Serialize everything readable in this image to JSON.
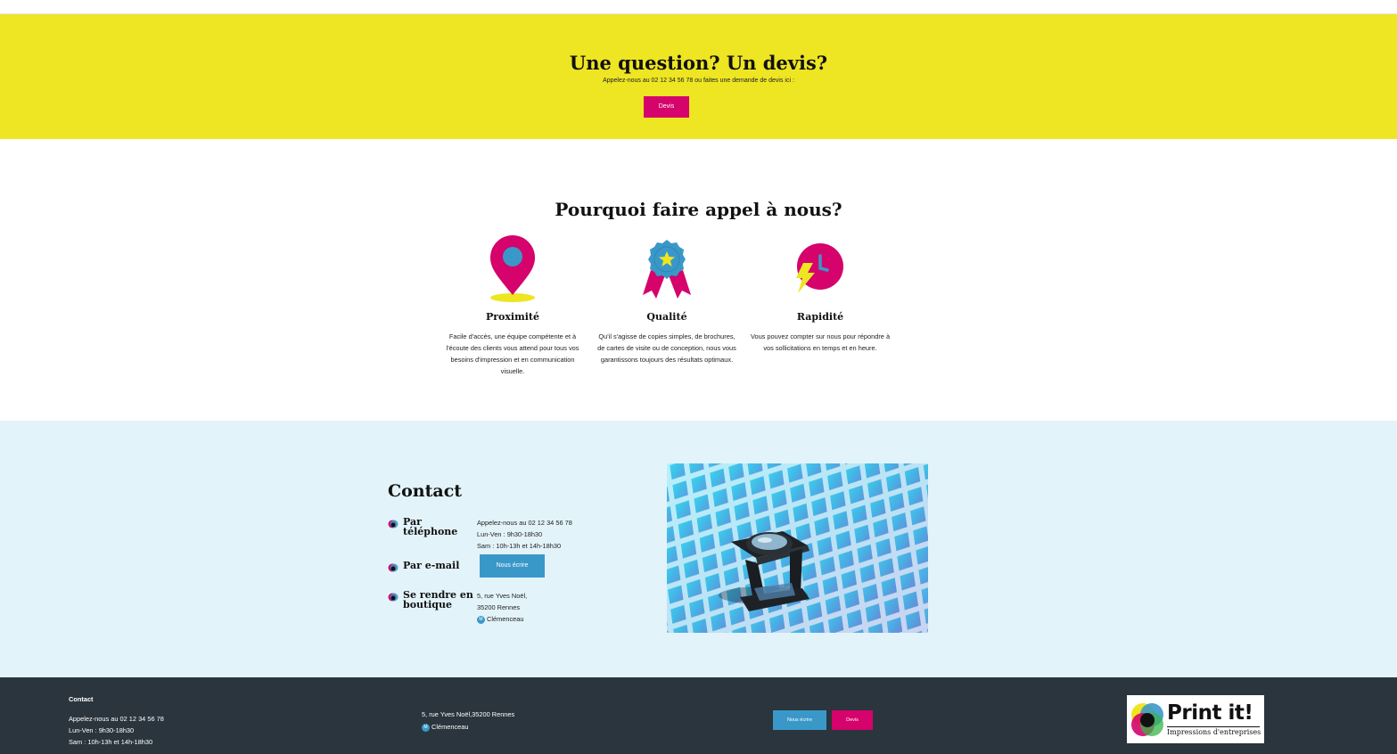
{
  "cta": {
    "title": "Une question? Un devis?",
    "subtitle": "Appelez-nous au 02 12 34 56 78 ou faites une demande de devis ici :",
    "button": "Devis"
  },
  "why": {
    "title": "Pourquoi faire appel à nous?",
    "features": [
      {
        "title": "Proximité",
        "text": "Facile d'accès, une équipe compétente et à l'écoute des clients vous attend pour tous vos besoins d'impression et en communication visuelle.",
        "icon": "location-pin-icon"
      },
      {
        "title": "Qualité",
        "text": "Qu'il s'agisse de copies simples, de brochures, de cartes de visite ou de conception, nous vous garantissons toujours des résultats optimaux.",
        "icon": "award-ribbon-icon"
      },
      {
        "title": "Rapidité",
        "text": "Vous pouvez compter sur nous pour répondre à vos sollicitations en temps et en heure.",
        "icon": "clock-lightning-icon"
      }
    ]
  },
  "contact": {
    "title": "Contact",
    "phone": {
      "label": "Par téléphone",
      "lines": [
        "Appelez-nous au 02 12 34 56 78",
        "Lun-Ven : 9h30-18h30",
        "Sam : 10h-13h et 14h-18h30"
      ]
    },
    "email": {
      "label": "Par e-mail",
      "button": "Nous écrire"
    },
    "shop": {
      "label": "Se rendre en boutique",
      "lines": [
        "5, rue Yves Noël,",
        "35200 Rennes"
      ],
      "metro_badge": "M",
      "metro": "Clémenceau"
    }
  },
  "footer": {
    "title": "Contact",
    "lines": [
      "Appelez-nous au 02 12 34 56 78",
      "Lun-Ven : 9h30-18h30",
      "Sam : 10h-13h et 14h-18h30"
    ],
    "address": "5, rue Yves Noël,35200 Rennes",
    "metro_badge": "M",
    "metro": "Clémenceau",
    "button_write": "Nous écrire",
    "button_quote": "Devis",
    "logo_name": "Print it!",
    "logo_tagline": "Impressions d'entreprises"
  },
  "colors": {
    "yellow": "#eee523",
    "magenta": "#d5036b",
    "blue": "#3a98c9",
    "light_blue_bg": "#e3f3fa",
    "footer_bg": "#2a353d"
  }
}
